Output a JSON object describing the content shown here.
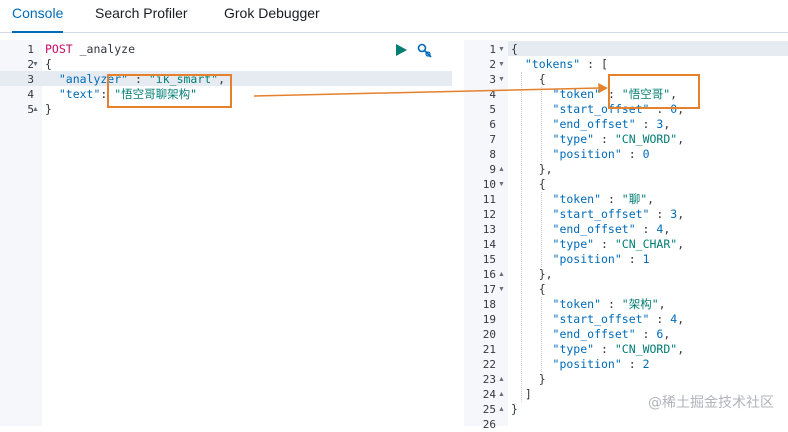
{
  "tabs": [
    {
      "label": "Console"
    },
    {
      "label": "Search Profiler"
    },
    {
      "label": "Grok Debugger"
    }
  ],
  "request": {
    "line_numbers": [
      "1",
      "2",
      "3",
      "4",
      "5"
    ],
    "lines": [
      {
        "method": "POST",
        "path": " _analyze"
      },
      {
        "text": "{"
      },
      {
        "key": "  \"analyzer\"",
        "punc": " : ",
        "str": "\"ik_smart\"",
        "tail": ","
      },
      {
        "key": "  \"text\"",
        "punc": ": ",
        "str": "\"悟空哥聊架构\"",
        "tail": ""
      },
      {
        "text": "}"
      }
    ]
  },
  "response": {
    "line_numbers": [
      "1",
      "2",
      "3",
      "4",
      "5",
      "6",
      "7",
      "8",
      "9",
      "10",
      "11",
      "12",
      "13",
      "14",
      "15",
      "16",
      "17",
      "18",
      "19",
      "20",
      "21",
      "22",
      "23",
      "24",
      "25",
      "26"
    ],
    "lines": [
      {
        "text": "{"
      },
      {
        "key": "  \"tokens\"",
        "punc": " : ["
      },
      {
        "text": "    {"
      },
      {
        "key": "      \"token\"",
        "punc": " : ",
        "str": "\"悟空哥\"",
        "tail": ","
      },
      {
        "key": "      \"start_offset\"",
        "punc": " : ",
        "num": "0",
        "tail": ","
      },
      {
        "key": "      \"end_offset\"",
        "punc": " : ",
        "num": "3",
        "tail": ","
      },
      {
        "key": "      \"type\"",
        "punc": " : ",
        "str": "\"CN_WORD\"",
        "tail": ","
      },
      {
        "key": "      \"position\"",
        "punc": " : ",
        "num": "0",
        "tail": ""
      },
      {
        "text": "    },"
      },
      {
        "text": "    {"
      },
      {
        "key": "      \"token\"",
        "punc": " : ",
        "str": "\"聊\"",
        "tail": ","
      },
      {
        "key": "      \"start_offset\"",
        "punc": " : ",
        "num": "3",
        "tail": ","
      },
      {
        "key": "      \"end_offset\"",
        "punc": " : ",
        "num": "4",
        "tail": ","
      },
      {
        "key": "      \"type\"",
        "punc": " : ",
        "str": "\"CN_CHAR\"",
        "tail": ","
      },
      {
        "key": "      \"position\"",
        "punc": " : ",
        "num": "1",
        "tail": ""
      },
      {
        "text": "    },"
      },
      {
        "text": "    {"
      },
      {
        "key": "      \"token\"",
        "punc": " : ",
        "str": "\"架构\"",
        "tail": ","
      },
      {
        "key": "      \"start_offset\"",
        "punc": " : ",
        "num": "4",
        "tail": ","
      },
      {
        "key": "      \"end_offset\"",
        "punc": " : ",
        "num": "6",
        "tail": ","
      },
      {
        "key": "      \"type\"",
        "punc": " : ",
        "str": "\"CN_WORD\"",
        "tail": ","
      },
      {
        "key": "      \"position\"",
        "punc": " : ",
        "num": "2",
        "tail": ""
      },
      {
        "text": "    }"
      },
      {
        "text": "  ]"
      },
      {
        "text": "}"
      },
      {
        "text": ""
      }
    ]
  },
  "watermark": "@稀土掘金技术社区",
  "colors": {
    "accent": "#006bb8",
    "highlight_box": "#e5812c",
    "method": "#c80a68",
    "string": "#017d73"
  },
  "icons": {
    "run": "play-icon",
    "settings": "wrench-icon"
  }
}
